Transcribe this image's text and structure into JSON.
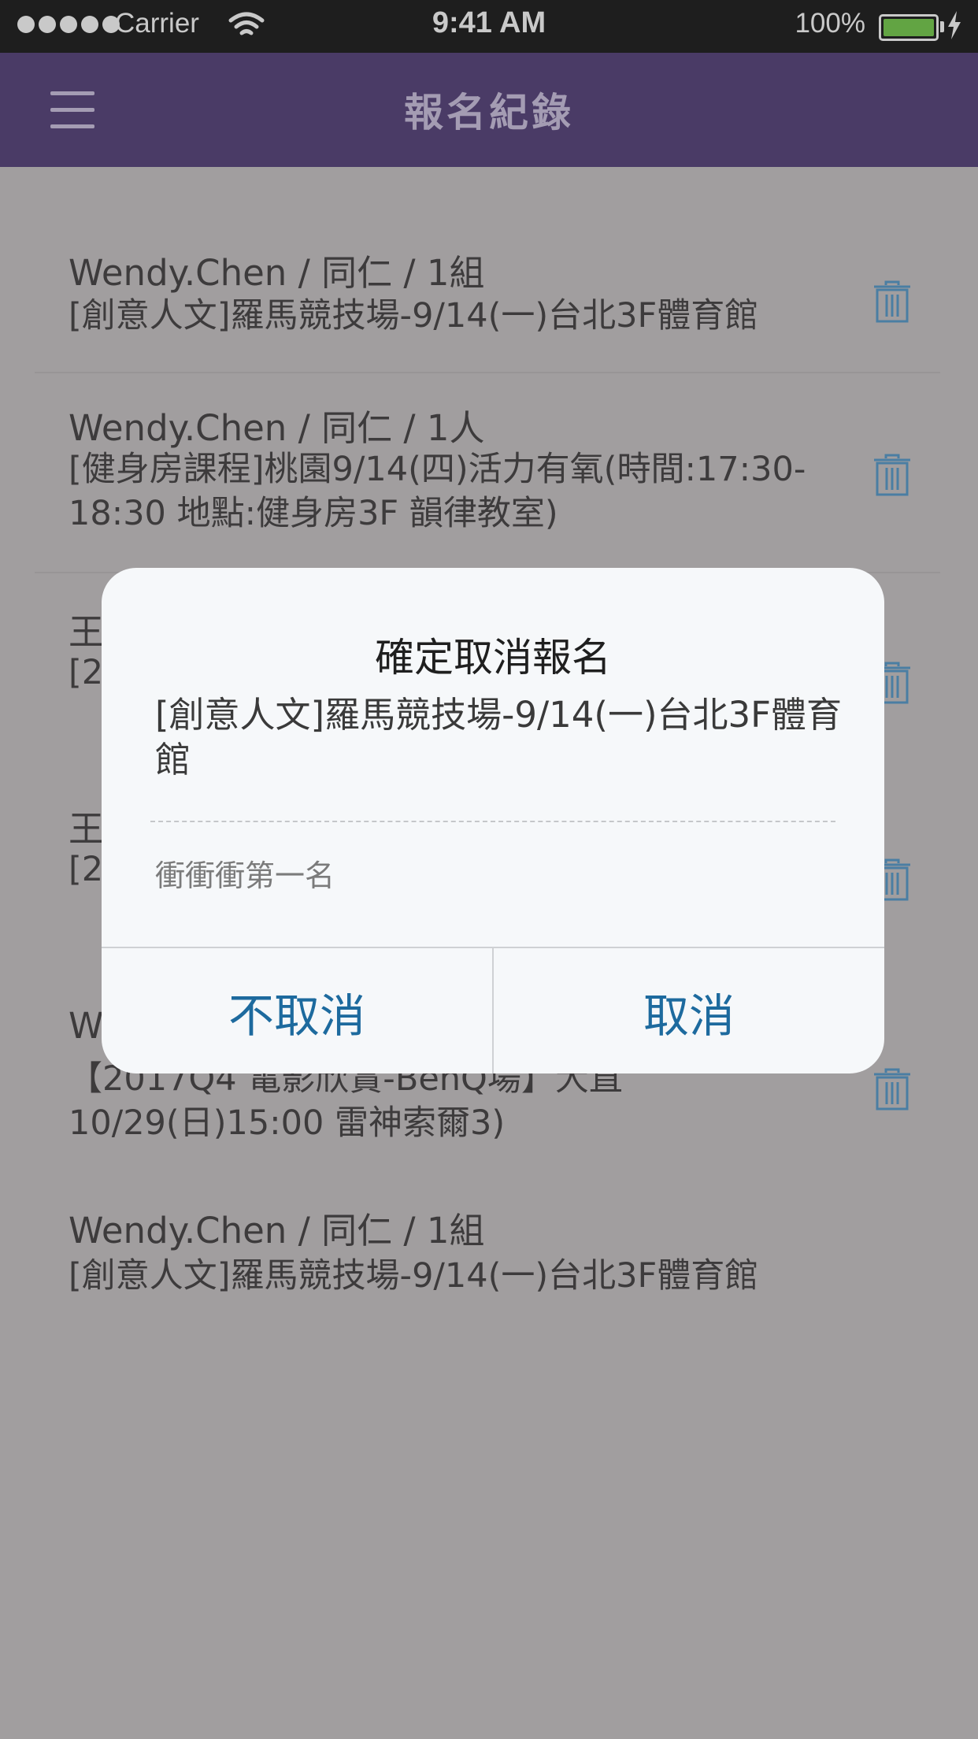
{
  "status_bar": {
    "carrier": "Carrier",
    "time": "9:41 AM",
    "battery": "100%"
  },
  "nav": {
    "title": "報名紀錄",
    "menu_icon": "hamburger-menu-icon"
  },
  "records": [
    {
      "name": "Wendy.Chen / 同仁 / 1組",
      "event": "[創意人文]羅馬競技場-9/14(一)台北3F體育館"
    },
    {
      "name": "Wendy.Chen / 同仁 / 1人",
      "event": "[健身房課程]桃園9/14(四)活力有氧(時間:17:30-18:30 地點:健身房3F 韻律教室)"
    },
    {
      "name": "王",
      "event": "[2"
    },
    {
      "name": "王",
      "event": "[2"
    },
    {
      "name": "W",
      "event": "【2017Q4 電影欣賞-BenQ場】大直10/29(日)15:00 雷神索爾3)"
    },
    {
      "name": "Wendy.Chen / 同仁 / 1組",
      "event": "[創意人文]羅馬競技場-9/14(一)台北3F體育館"
    }
  ],
  "dialog": {
    "title": "確定取消報名",
    "event": "[創意人文]羅馬競技場-9/14(一)台北3F體育館",
    "note": "衝衝衝第一名",
    "keep_label": "不取消",
    "confirm_label": "取消"
  },
  "colors": {
    "nav_bg": "#4a3b66",
    "overlay_bg": "#a19e9f",
    "button_text": "#1d6a9e",
    "battery": "#62a443"
  }
}
